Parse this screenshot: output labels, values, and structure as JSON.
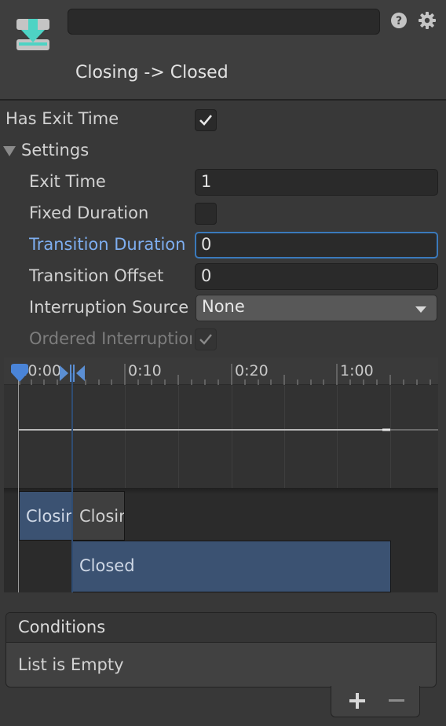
{
  "header": {
    "icon": "state-transition-download-icon",
    "name_value": "",
    "title": "Closing -> Closed",
    "accent_color": "#4ed3c4"
  },
  "properties": {
    "has_exit_time": {
      "label": "Has Exit Time",
      "checked": true
    },
    "settings_foldout": {
      "label": "Settings",
      "expanded": true
    },
    "exit_time": {
      "label": "Exit Time",
      "value": "1"
    },
    "fixed_duration": {
      "label": "Fixed Duration",
      "checked": false
    },
    "transition_duration": {
      "label": "Transition Duration",
      "value": "0",
      "focused": true
    },
    "transition_offset": {
      "label": "Transition Offset",
      "value": "0"
    },
    "interruption_source": {
      "label": "Interruption Source",
      "value": "None"
    },
    "ordered_interruption": {
      "label": "Ordered Interruption",
      "checked": true,
      "disabled": true
    }
  },
  "timeline": {
    "tick_labels": [
      ":0:00",
      "0:10",
      "0:20",
      "1:00"
    ],
    "clips": {
      "source_clip_1": "Closing",
      "source_clip_2": "Closing",
      "destination_clip": "Closed"
    },
    "clip_color": "#3b5272"
  },
  "conditions": {
    "header": "Conditions",
    "empty_text": "List is Empty"
  },
  "footer": {
    "add_label": "+",
    "remove_label": "−"
  }
}
